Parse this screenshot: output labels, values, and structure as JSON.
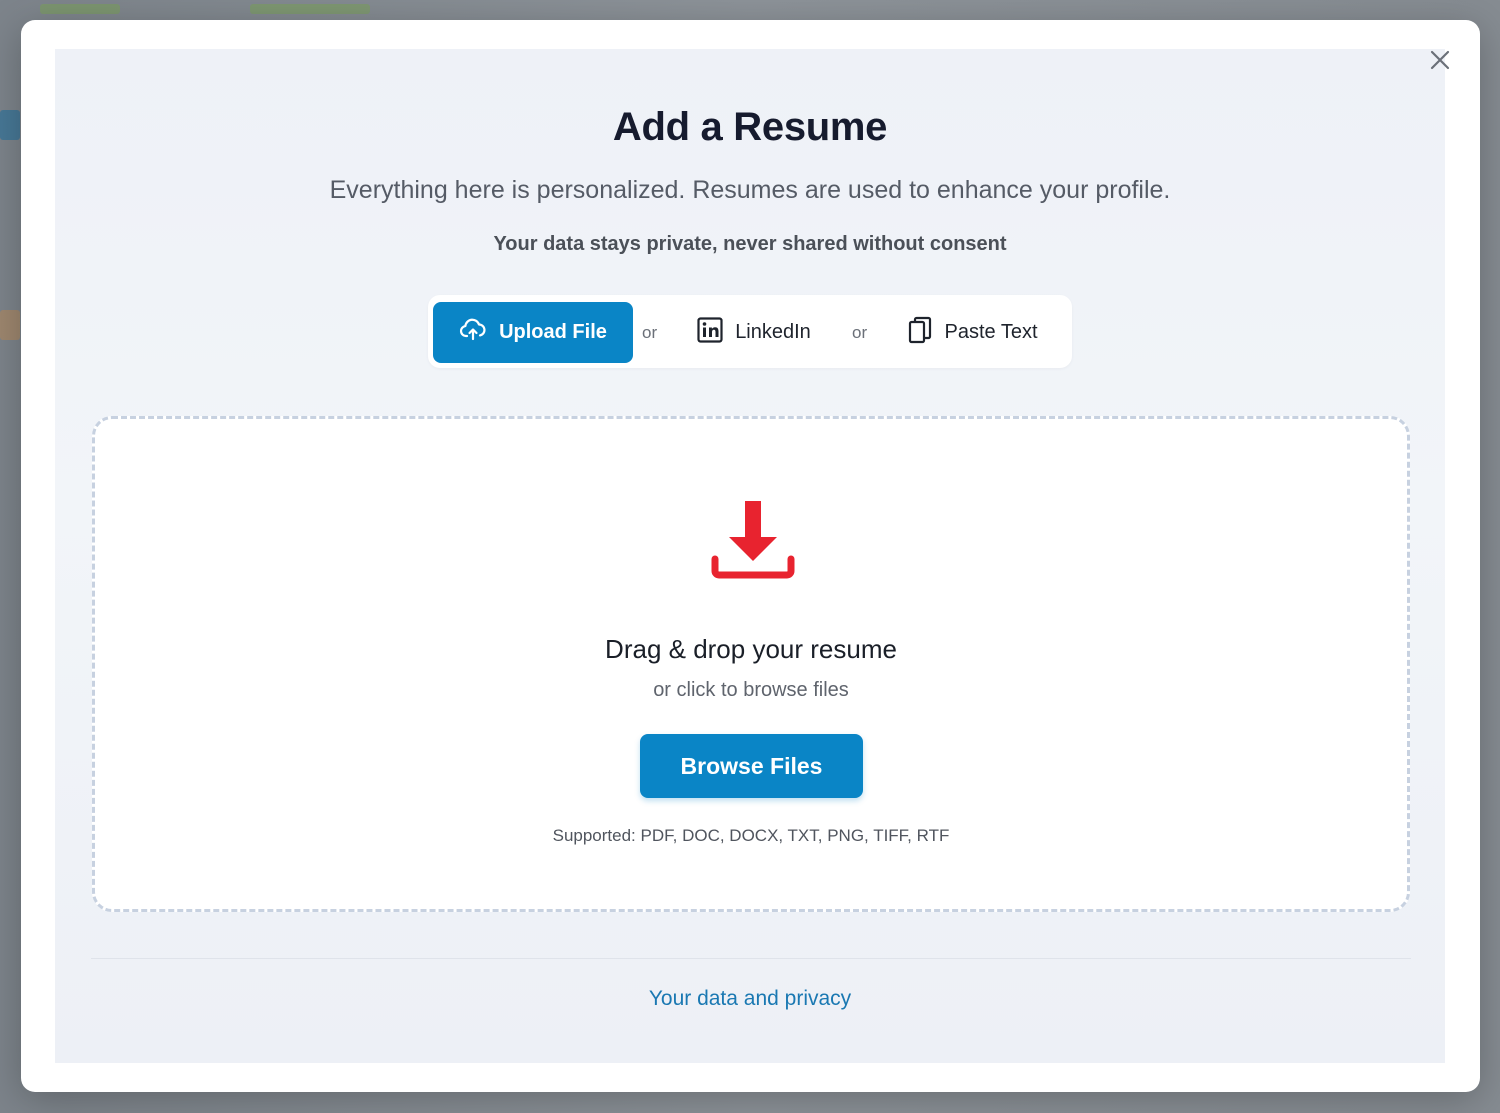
{
  "modal": {
    "title": "Add a Resume",
    "subtitle": "Everything here is personalized. Resumes are used to enhance your profile.",
    "privacy_note": "Your data stays private, never shared without consent"
  },
  "tabs": {
    "items": [
      {
        "label": "Upload File",
        "icon": "cloud-upload-icon",
        "active": true
      },
      {
        "label": "LinkedIn",
        "icon": "linkedin-icon",
        "active": false
      },
      {
        "label": "Paste Text",
        "icon": "clipboard-icon",
        "active": false
      }
    ],
    "separator": "or"
  },
  "dropzone": {
    "icon": "download-icon",
    "title": "Drag & drop your resume",
    "subtitle": "or click to browse files",
    "button_label": "Browse Files",
    "supported": "Supported: PDF, DOC, DOCX, TXT, PNG, TIFF, RTF"
  },
  "footer": {
    "privacy_link": "Your data and privacy"
  },
  "colors": {
    "accent": "#0a85c6",
    "drop_icon": "#e8232f",
    "link": "#1a78b2"
  }
}
